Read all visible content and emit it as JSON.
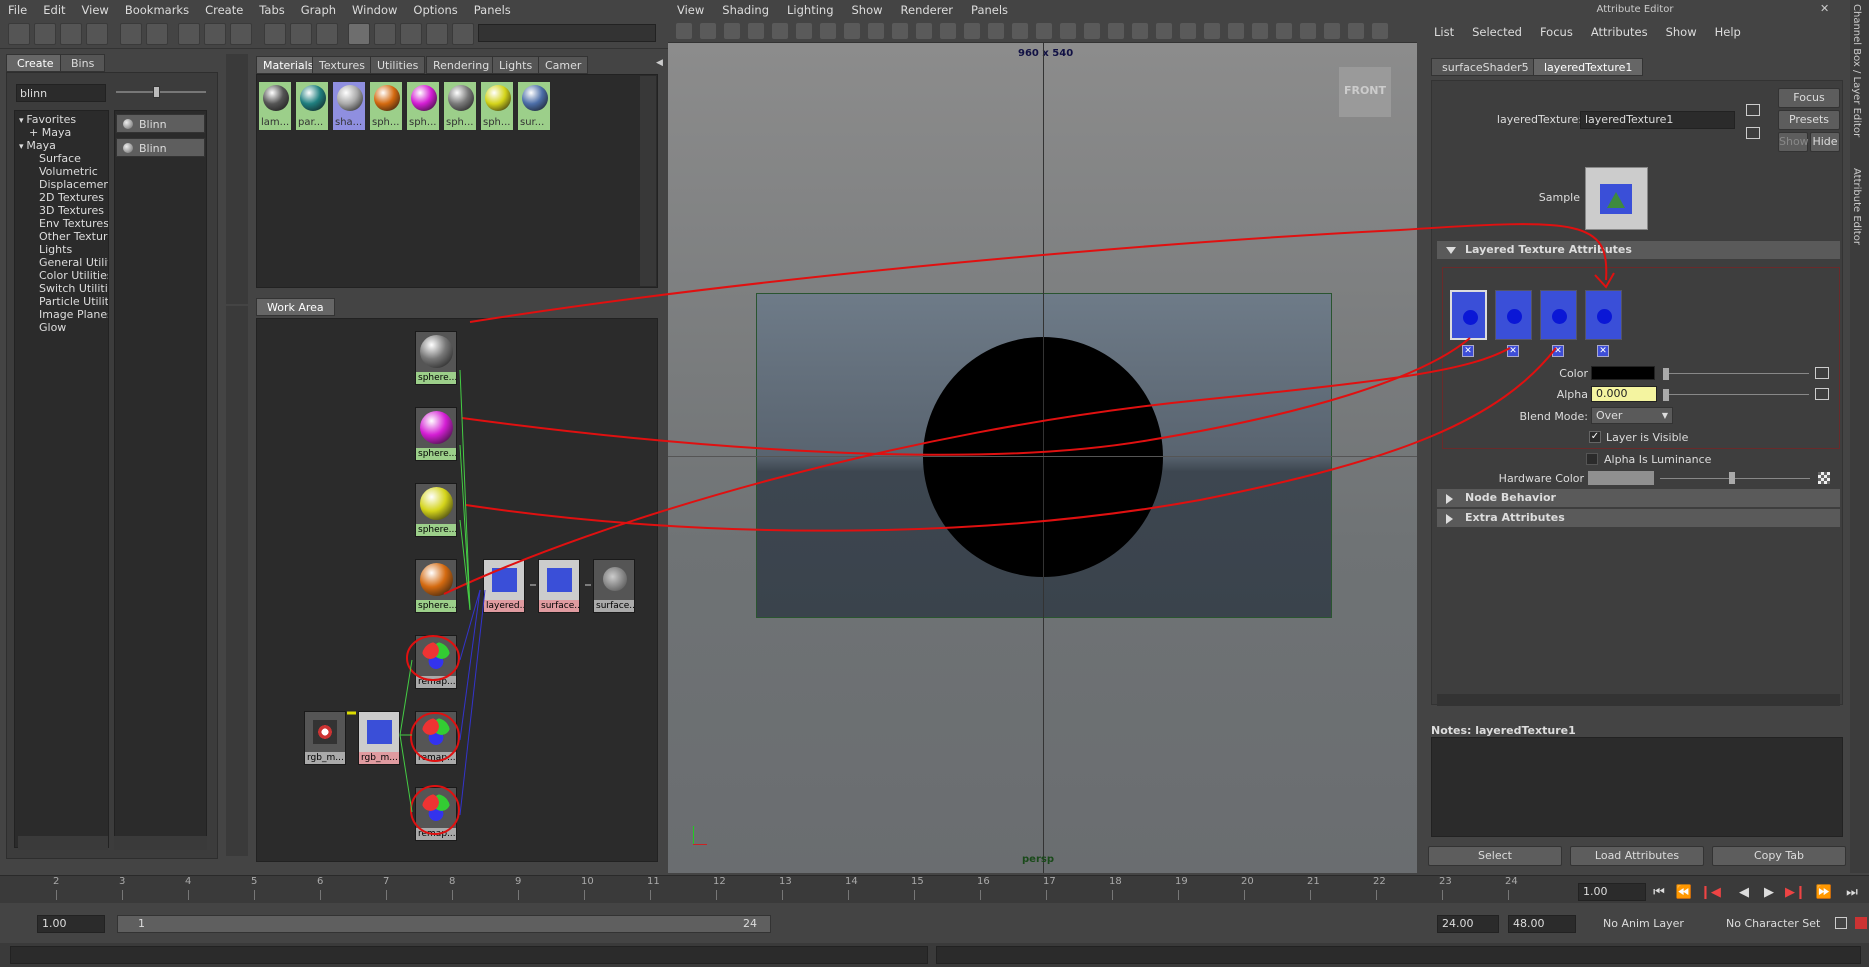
{
  "menubar": [
    "File",
    "Edit",
    "View",
    "Bookmarks",
    "Create",
    "Tabs",
    "Graph",
    "Window",
    "Options",
    "Panels"
  ],
  "create_tabs": {
    "create": "Create",
    "bins": "Bins"
  },
  "search": {
    "value": "blinn"
  },
  "tree": [
    {
      "label": "Favorites",
      "indent": 0,
      "arrow": "down"
    },
    {
      "label": "+ Maya",
      "indent": 1,
      "arrow": ""
    },
    {
      "label": "Maya",
      "indent": 0,
      "arrow": "down"
    },
    {
      "label": "Surface",
      "indent": 2,
      "arrow": ""
    },
    {
      "label": "Volumetric",
      "indent": 2,
      "arrow": ""
    },
    {
      "label": "Displacement",
      "indent": 2,
      "arrow": ""
    },
    {
      "label": "2D Textures",
      "indent": 2,
      "arrow": ""
    },
    {
      "label": "3D Textures",
      "indent": 2,
      "arrow": ""
    },
    {
      "label": "Env Textures",
      "indent": 2,
      "arrow": ""
    },
    {
      "label": "Other Textures",
      "indent": 2,
      "arrow": ""
    },
    {
      "label": "Lights",
      "indent": 2,
      "arrow": ""
    },
    {
      "label": "General Utilities",
      "indent": 2,
      "arrow": ""
    },
    {
      "label": "Color Utilities",
      "indent": 2,
      "arrow": ""
    },
    {
      "label": "Switch Utilities",
      "indent": 2,
      "arrow": ""
    },
    {
      "label": "Particle Utilities",
      "indent": 2,
      "arrow": ""
    },
    {
      "label": "Image Planes",
      "indent": 2,
      "arrow": ""
    },
    {
      "label": "Glow",
      "indent": 2,
      "arrow": ""
    }
  ],
  "blinn_items": [
    "Blinn",
    "Blinn"
  ],
  "material_tabs": [
    "Materials",
    "Textures",
    "Utilities",
    "Rendering",
    "Lights",
    "Camer"
  ],
  "swatches": [
    {
      "label": "lam...",
      "color": "#555",
      "bg": "#9ccf8a"
    },
    {
      "label": "par...",
      "color": "#1f7f7f",
      "bg": "#9ccf8a"
    },
    {
      "label": "sha...",
      "color": "#aaa",
      "bg": "#8f8fe0"
    },
    {
      "label": "sph...",
      "color": "#d46a10",
      "bg": "#9ccf8a"
    },
    {
      "label": "sph...",
      "color": "#d41ed4",
      "bg": "#9ccf8a"
    },
    {
      "label": "sph...",
      "color": "#7a7a7a",
      "bg": "#9ccf8a"
    },
    {
      "label": "sph...",
      "color": "#d4d41a",
      "bg": "#9ccf8a"
    },
    {
      "label": "sur...",
      "color": "#4c6ea8",
      "bg": "#9ccf8a"
    }
  ],
  "work_area": {
    "tab": "Work Area"
  },
  "nodes": [
    {
      "label": "sphere...",
      "kind": "gray"
    },
    {
      "label": "sphere...",
      "kind": "magenta"
    },
    {
      "label": "sphere...",
      "kind": "yellow"
    },
    {
      "label": "sphere...",
      "kind": "orange"
    },
    {
      "label": "layered...",
      "kind": "texture"
    },
    {
      "label": "surface...",
      "kind": "texture"
    },
    {
      "label": "surface...",
      "kind": "sg"
    },
    {
      "label": "remap...",
      "kind": "remap"
    },
    {
      "label": "remap...",
      "kind": "remap"
    },
    {
      "label": "remap...",
      "kind": "remap"
    },
    {
      "label": "rgb_m...",
      "kind": "rgb"
    },
    {
      "label": "rgb_m...",
      "kind": "texture"
    }
  ],
  "viewport": {
    "menu": [
      "View",
      "Shading",
      "Lighting",
      "Show",
      "Renderer",
      "Panels"
    ],
    "resolution": "960 x 540",
    "front_label": "FRONT",
    "camera": "persp"
  },
  "attribute_editor": {
    "title": "Attribute Editor",
    "menu": [
      "List",
      "Selected",
      "Focus",
      "Attributes",
      "Show",
      "Help"
    ],
    "tabs": [
      "surfaceShader5",
      "layeredTexture1"
    ],
    "node_type_label": "layeredTexture:",
    "node_name": "layeredTexture1",
    "focus": "Focus",
    "presets": "Presets",
    "show": "Show",
    "hide": "Hide",
    "sample_label": "Sample",
    "section_layered": "Layered Texture Attributes",
    "color_label": "Color",
    "alpha_label": "Alpha",
    "alpha_value": "0.000",
    "blend_label": "Blend Mode:",
    "blend_value": "Over",
    "layer_visible": "Layer is Visible",
    "alpha_luminance": "Alpha Is Luminance",
    "hardware_color": "Hardware Color",
    "section_node_behavior": "Node Behavior",
    "section_extra": "Extra Attributes",
    "notes_label": "Notes:  layeredTexture1",
    "buttons": [
      "Select",
      "Load Attributes",
      "Copy Tab"
    ],
    "side_tabs": [
      "Channel Box / Layer Editor",
      "Attribute Editor"
    ]
  },
  "timeline": {
    "ticks": [
      "2",
      "3",
      "4",
      "5",
      "6",
      "7",
      "8",
      "9",
      "10",
      "11",
      "12",
      "13",
      "14",
      "15",
      "16",
      "17",
      "18",
      "19",
      "20",
      "21",
      "22",
      "23",
      "24"
    ],
    "current": "1.00"
  },
  "range": {
    "start": "1.00",
    "slider_start": "1",
    "slider_end": "24",
    "end": "24.00",
    "max": "48.00",
    "anim_layer": "No Anim Layer",
    "char_set": "No Character Set"
  }
}
